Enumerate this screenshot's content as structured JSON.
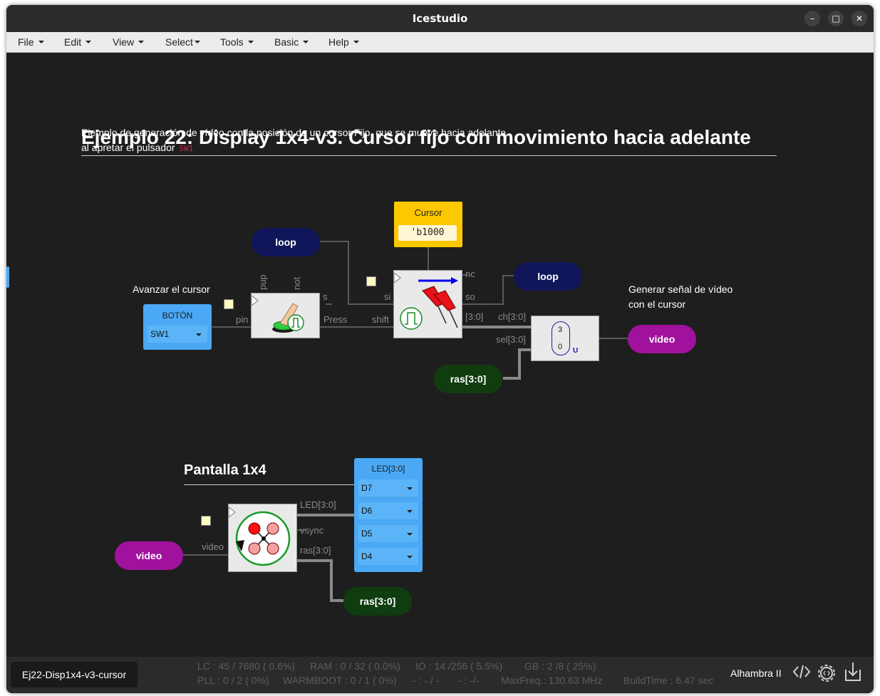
{
  "window": {
    "title": "Icestudio"
  },
  "menubar": {
    "items": [
      "File",
      "Edit",
      "View",
      "Select",
      "Tools",
      "Basic",
      "Help"
    ]
  },
  "doc": {
    "title": "Ejemplo 22: Display 1x4-v3. Cursor fijo con movimiento hacia adelante",
    "desc_line1": "Ejemplo de generación de vídeo con la posición de un cursor Fijo, que se mueve hacia adelante",
    "desc_line2": "al apretar el pulsador",
    "desc_code": "SW1",
    "subtitle": "Pantalla 1x4"
  },
  "comments": {
    "avanzar": "Avanzar el cursor",
    "generar_line1": "Generar señal de vídeo",
    "generar_line2": "con el cursor"
  },
  "blocks": {
    "boton": {
      "title": "BOTÓN",
      "value": "SW1"
    },
    "cursor": {
      "title": "Cursor",
      "value": "'b1000"
    },
    "button_ports": {
      "pup": "pup",
      "not": "not",
      "pin": "pin",
      "s": "s",
      "press": "Press"
    },
    "shift_ports": {
      "si": "si",
      "shift": "shift",
      "nc": "nc",
      "so": "so",
      "out": "[3:0]"
    },
    "mux_ports": {
      "ch": "ch[3:0]",
      "sel": "sel[3:0]",
      "top": "3",
      "bottom": "0",
      "u": "U"
    },
    "display_ports": {
      "video": "video",
      "led": "LED[3:0]",
      "vsync": "vsync",
      "ras": "ras[3:0]"
    },
    "led": {
      "title": "LED[3:0]",
      "values": [
        "D7",
        "D6",
        "D5",
        "D4"
      ]
    }
  },
  "labels": {
    "loop1": "loop",
    "loop2": "loop",
    "video_out": "video",
    "ras_in": "ras[3:0]",
    "video_in": "video",
    "ras_out": "ras[3:0]"
  },
  "status": {
    "project": "Ej22-Disp1x4-v3-cursor",
    "lc": "LC : 45 / 7680 ( 0.6%)",
    "ram": "RAM : 0 / 32 ( 0.0%)",
    "io": "IO :  14 /256  ( 5.5%)",
    "gb": "GB :  2 /8  ( 25%)",
    "pll": "PLL : 0 / 2 ( 0%)",
    "warmboot": "WARMBOOT : 0 / 1 ( 0%)",
    "blank1": "- : - / -",
    "blank2": "- :  -/-",
    "maxfreq": "MaxFreq.:  130.63 MHz",
    "buildtime": "BuildTime :   6.47 sec",
    "board": "Alhambra II"
  },
  "icons": [
    "chevron-down-icon",
    "minimize-icon",
    "maximize-icon",
    "close-icon",
    "code-icon",
    "settings-gear-icon",
    "download-icon",
    "pushbutton-icon",
    "pushpin-shift-icon",
    "processor-circle-icon"
  ],
  "colors": {
    "label_navy": "#101659",
    "label_purple": "#a0129e",
    "label_green": "#0f3d0f",
    "io_blue": "#4aa8f5",
    "constant_yellow": "#fcc800"
  }
}
